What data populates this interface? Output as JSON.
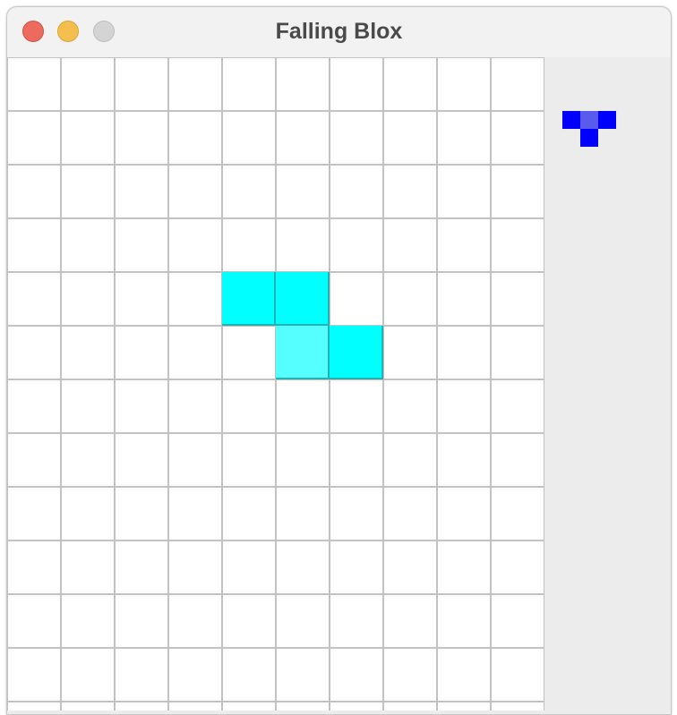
{
  "window": {
    "title": "Falling Blox"
  },
  "game": {
    "board_columns": 10,
    "board_rows_visible": 12,
    "active_piece": {
      "shape": "S",
      "color": "#00ffff",
      "cells": [
        {
          "col": 4,
          "row": 4
        },
        {
          "col": 5,
          "row": 4
        },
        {
          "col": 5,
          "row": 5
        },
        {
          "col": 6,
          "row": 5
        }
      ]
    },
    "next_piece": {
      "shape": "T",
      "color": "#0000ff",
      "cells": [
        {
          "col": 0,
          "row": 0
        },
        {
          "col": 1,
          "row": 0
        },
        {
          "col": 2,
          "row": 0
        },
        {
          "col": 1,
          "row": 1
        }
      ]
    }
  }
}
